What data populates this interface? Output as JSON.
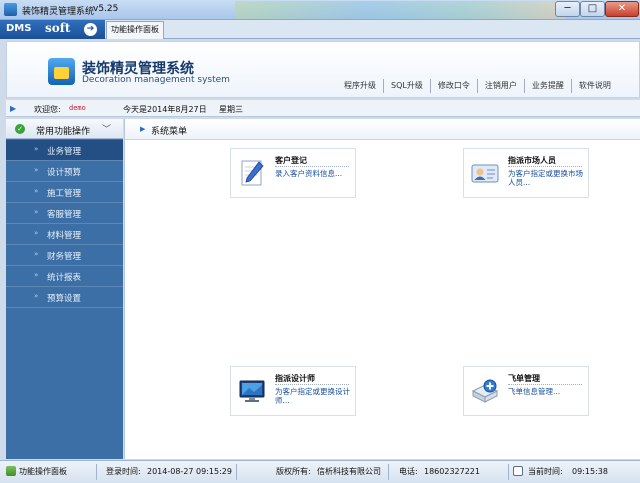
{
  "window": {
    "title": "装饰精灵管理系统",
    "version": "v5.25",
    "min": "─",
    "max": "□",
    "close": "✕"
  },
  "tabstrip": {
    "brand_dms": "DMS",
    "brand_soft": "soft",
    "brand_arrow": "➔",
    "tab_label": "功能操作面板"
  },
  "header": {
    "title": "装饰精灵管理系统",
    "subtitle": "Decoration management system",
    "nav": [
      "程序升级",
      "SQL升级",
      "修改口令",
      "注销用户",
      "业务提醒",
      "软件说明"
    ]
  },
  "infobar": {
    "welcome": "欢迎您:",
    "user": "demo",
    "today": "今天是2014年8月27日",
    "weekday": "星期三"
  },
  "sidebar": {
    "header": "常用功能操作",
    "items": [
      {
        "label": "业务管理",
        "active": true
      },
      {
        "label": "设计预算",
        "active": false
      },
      {
        "label": "施工管理",
        "active": false
      },
      {
        "label": "客服管理",
        "active": false
      },
      {
        "label": "材料管理",
        "active": false
      },
      {
        "label": "财务管理",
        "active": false
      },
      {
        "label": "统计报表",
        "active": false
      },
      {
        "label": "预算设置",
        "active": false
      }
    ]
  },
  "main": {
    "title": "系统菜单",
    "cards": [
      {
        "title": "客户登记",
        "desc": "录入客户资料信息...",
        "icon": "pen-paper-icon"
      },
      {
        "title": "指派市场人员",
        "desc": "为客户指定或更换市场人员...",
        "icon": "id-card-icon"
      },
      {
        "title": "指派设计师",
        "desc": "为客户指定或更换设计师...",
        "icon": "monitor-icon"
      },
      {
        "title": "飞单管理",
        "desc": "飞单信息管理...",
        "icon": "add-box-icon"
      }
    ]
  },
  "statusbar": {
    "panel_label": "功能操作面板",
    "login_label": "登录时间:",
    "login_time": "2014-08-27 09:15:29",
    "copyright_label": "版权所有:",
    "copyright": "信析科技有限公司",
    "phone_label": "电话:",
    "phone": "18602327221",
    "current_label": "当前时间:",
    "current_time": "09:15:38"
  },
  "colors": {
    "sidebar_bg": "#3c6fa6",
    "sidebar_active": "#244f84",
    "link_blue": "#1a4fa0",
    "user_red": "#c0202a"
  }
}
